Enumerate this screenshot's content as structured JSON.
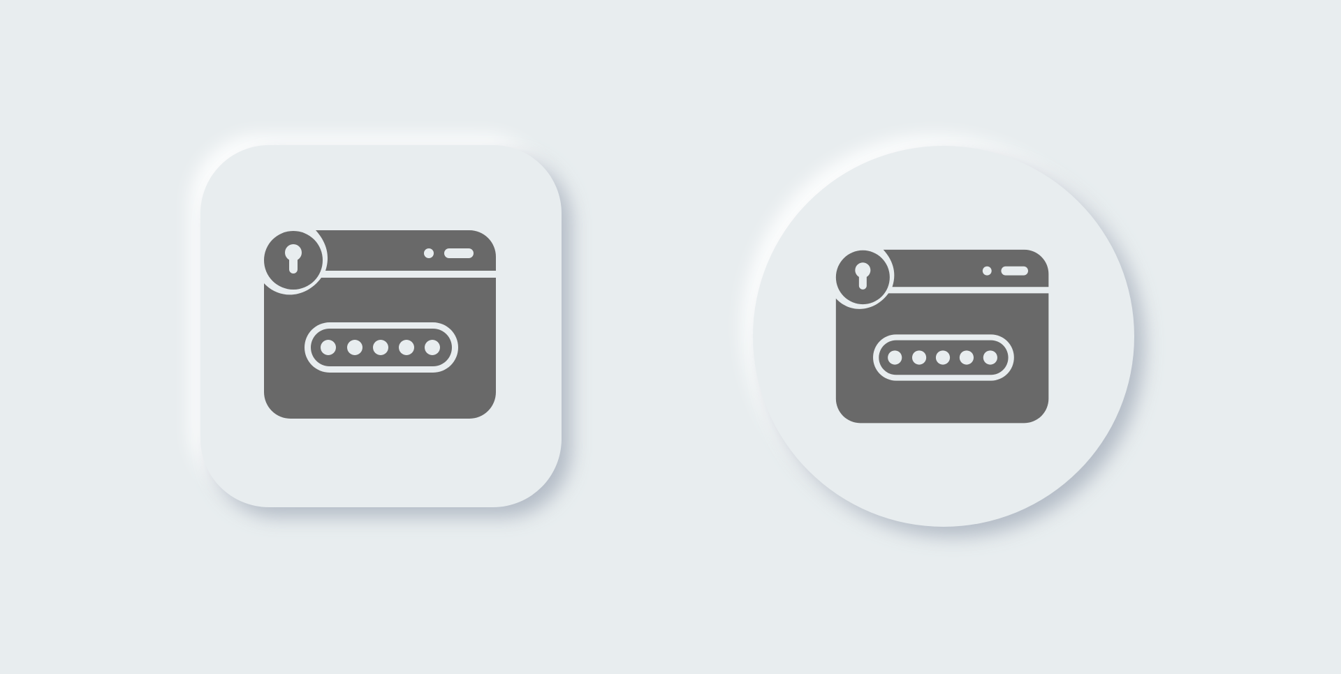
{
  "colors": {
    "background": "#e8edef",
    "icon_fill": "#696969",
    "icon_cutout": "#e8edef"
  },
  "icons": [
    {
      "name": "password-window-icon",
      "container": "rounded-square",
      "password_dots": 5
    },
    {
      "name": "password-window-icon",
      "container": "circle",
      "password_dots": 5
    }
  ]
}
